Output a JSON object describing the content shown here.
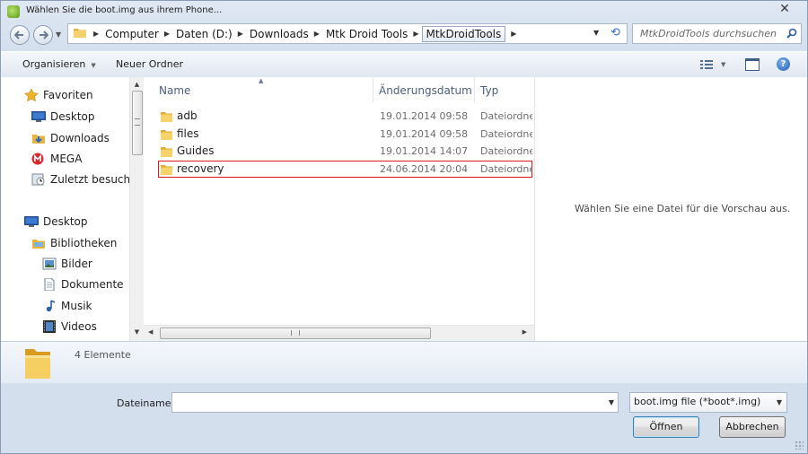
{
  "window": {
    "title": "Wählen Sie die boot.img aus ihrem Phone..."
  },
  "address": {
    "crumbs": [
      "Computer",
      "Daten (D:)",
      "Downloads",
      "Mtk Droid Tools",
      "MtkDroidTools"
    ],
    "search_placeholder": "MtkDroidTools durchsuchen"
  },
  "toolbar": {
    "organize": "Organisieren",
    "new_folder": "Neuer Ordner"
  },
  "nav": {
    "favorites": "Favoriten",
    "fav_items": [
      "Desktop",
      "Downloads",
      "MEGA",
      "Zuletzt besucht"
    ],
    "desktop": "Desktop",
    "libraries": "Bibliotheken",
    "lib_items": [
      "Bilder",
      "Dokumente",
      "Musik",
      "Videos"
    ]
  },
  "columns": {
    "name": "Name",
    "date": "Änderungsdatum",
    "type": "Typ"
  },
  "files": [
    {
      "name": "adb",
      "date": "19.01.2014 09:58",
      "type": "Dateiordner"
    },
    {
      "name": "files",
      "date": "19.01.2014 09:58",
      "type": "Dateiordner"
    },
    {
      "name": "Guides",
      "date": "19.01.2014 14:07",
      "type": "Dateiordner"
    },
    {
      "name": "recovery",
      "date": "24.06.2014 20:04",
      "type": "Dateiordner"
    }
  ],
  "preview": {
    "message": "Wählen Sie eine Datei für die Vorschau aus."
  },
  "details": {
    "count": "4 Elemente"
  },
  "bottom": {
    "filename_label": "Dateiname:",
    "filename_value": "",
    "filter": "boot.img file (*boot*.img)",
    "open": "Öffnen",
    "cancel": "Abbrechen"
  },
  "colors": {
    "highlight": "#e0161b",
    "accent": "#2e6cc0"
  }
}
